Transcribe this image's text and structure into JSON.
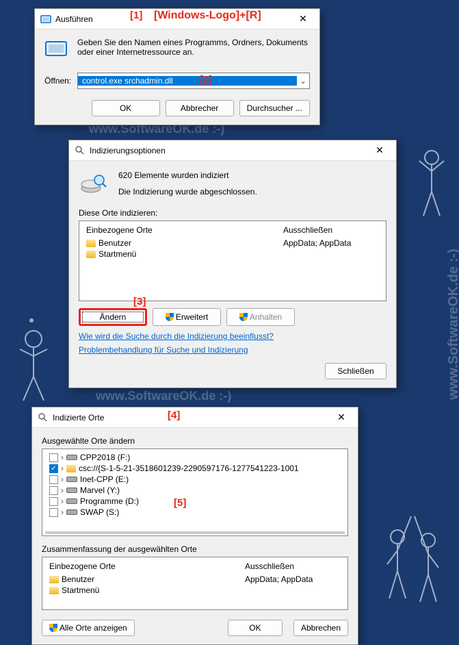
{
  "annotations": {
    "a1": "[1]",
    "a1_hint": "[Windows-Logo]+[R]",
    "a2": "[2]",
    "a3": "[3]",
    "a4": "[4]",
    "a5": "[5]"
  },
  "run": {
    "title": "Ausführen",
    "desc": "Geben Sie den Namen eines Programms, Ordners, Dokuments oder einer Internetressource an.",
    "open_label": "Öffnen:",
    "command": "control.exe srchadmin.dll",
    "ok": "OK",
    "cancel": "Abbrecher",
    "browse": "Durchsucher ..."
  },
  "index": {
    "title": "Indizierungsoptionen",
    "count_line": "620 Elemente wurden indiziert",
    "done_line": "Die Indizierung wurde abgeschlossen.",
    "locations_label": "Diese Orte indizieren:",
    "col_included": "Einbezogene Orte",
    "col_excluded": "Ausschließen",
    "rows": [
      {
        "name": "Benutzer",
        "exclude": "AppData; AppData"
      },
      {
        "name": "Startmenü",
        "exclude": ""
      }
    ],
    "modify": "Ändern",
    "advanced": "Erweitert",
    "pause": "Anhalten",
    "link1": "Wie wird die Suche durch die Indizierung beeinflusst?",
    "link2": "Problembehandlung für Suche und Indizierung",
    "close": "Schließen"
  },
  "loc": {
    "title": "Indizierte Orte",
    "change_label": "Ausgewählte Orte ändern",
    "items": [
      {
        "checked": false,
        "icon": "drive",
        "name": "CPP2018 (F:)"
      },
      {
        "checked": true,
        "icon": "folder",
        "name": "csc://{S-1-5-21-3518601239-2290597176-1277541223-1001"
      },
      {
        "checked": false,
        "icon": "drive",
        "name": "Inet-CPP (E:)"
      },
      {
        "checked": false,
        "icon": "drive",
        "name": "Marvel (Y:)"
      },
      {
        "checked": false,
        "icon": "drive",
        "name": "Programme (D:)"
      },
      {
        "checked": false,
        "icon": "drive",
        "name": "SWAP (S:)"
      }
    ],
    "summary_label": "Zusammenfassung der ausgewählten Orte",
    "col_included": "Einbezogene Orte",
    "col_excluded": "Ausschließen",
    "summary_rows": [
      {
        "name": "Benutzer",
        "exclude": "AppData; AppData"
      },
      {
        "name": "Startmenü",
        "exclude": ""
      }
    ],
    "show_all": "Alle Orte anzeigen",
    "ok": "OK",
    "cancel": "Abbrechen"
  },
  "watermarks": {
    "w1": "www.SoftwareOK.de :-)",
    "w2": "www.SoftwareOK.de :-)",
    "w3": "www.SoftwareOK.de :-)",
    "w4": "www.SoftwareOK.de :-)"
  }
}
